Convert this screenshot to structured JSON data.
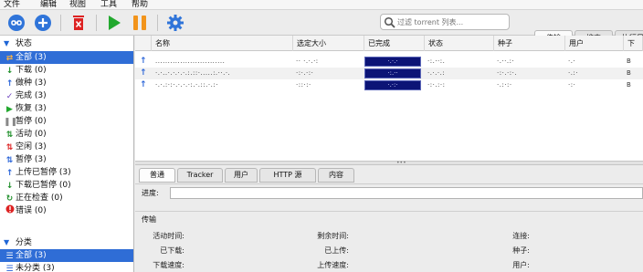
{
  "menu": [
    "文件",
    "编辑",
    "视图",
    "工具",
    "帮助"
  ],
  "toolbar": {
    "buttons": [
      "link-icon",
      "add-icon",
      "delete-icon",
      "play-icon",
      "pause-icon",
      "gear-icon"
    ],
    "search_placeholder": "过滤 torrent 列表..."
  },
  "right_tabs": [
    "传输",
    "搜索",
    "执行日"
  ],
  "sidebar": {
    "status_header": "状态",
    "status_items": [
      {
        "label": "全部 (3)",
        "icon": "all-icon"
      },
      {
        "label": "下载 (0)",
        "icon": "download-icon"
      },
      {
        "label": "做种 (3)",
        "icon": "seeding-icon"
      },
      {
        "label": "完成 (3)",
        "icon": "check-icon"
      },
      {
        "label": "恢复 (3)",
        "icon": "resume-icon"
      },
      {
        "label": "暂停 (0)",
        "icon": "pause-icon"
      },
      {
        "label": "活动 (0)",
        "icon": "active-icon"
      },
      {
        "label": "空闲 (3)",
        "icon": "inactive-icon"
      },
      {
        "label": "暂停 (3)",
        "icon": "stalled-icon"
      },
      {
        "label": "上传已暂停 (3)",
        "icon": "upload-stalled-icon"
      },
      {
        "label": "下载已暂停 (0)",
        "icon": "download-stalled-icon"
      },
      {
        "label": "正在检查 (0)",
        "icon": "checking-icon"
      },
      {
        "label": "错误 (0)",
        "icon": "error-icon"
      }
    ],
    "category_header": "分类",
    "category_items": [
      {
        "label": "全部 (3)",
        "icon": "list-icon"
      },
      {
        "label": "未分类 (3)",
        "icon": "list-icon"
      }
    ]
  },
  "columns": [
    "名称",
    "选定大小",
    "已完成",
    "状态",
    "种子",
    "用户",
    "下"
  ],
  "torrents": [
    {
      "name": "............................",
      "size": "·· ·.·.·:",
      "done": "·.·.·",
      "status": "·:.··:.",
      "seeds": "·.··.:·",
      "peers": "·.·",
      "down": "B"
    },
    {
      "name": "·.·..·.·.·.·.:.::·.....:.··.·.",
      "size": "·:·.·:·",
      "done": "·:.··",
      "status": "·.·.·.:",
      "seeds": "·:·.·:·.",
      "peers": "·.:·",
      "down": "B"
    },
    {
      "name": "·.·.:·:·.·.·.·:.·.::.·.:·",
      "size": "·::·:·",
      "done": "·.·:·",
      "status": "·:·.:·:",
      "seeds": "·.:·:·",
      "peers": "·:·",
      "down": "B"
    }
  ],
  "prop_tabs": [
    "普通",
    "Tracker",
    "用户",
    "HTTP 源",
    "内容"
  ],
  "progress_label": "进度:",
  "transfer": {
    "title": "传输",
    "col1": [
      "活动时间:",
      "已下载:",
      "下载速度:"
    ],
    "col2": [
      "剩余时间:",
      "已上传:",
      "上传速度:"
    ],
    "col3": [
      "连接:",
      "种子:",
      "用户:"
    ]
  },
  "colors": {
    "accent": "#2f6dd6",
    "progress_bar": "#0c1476"
  }
}
